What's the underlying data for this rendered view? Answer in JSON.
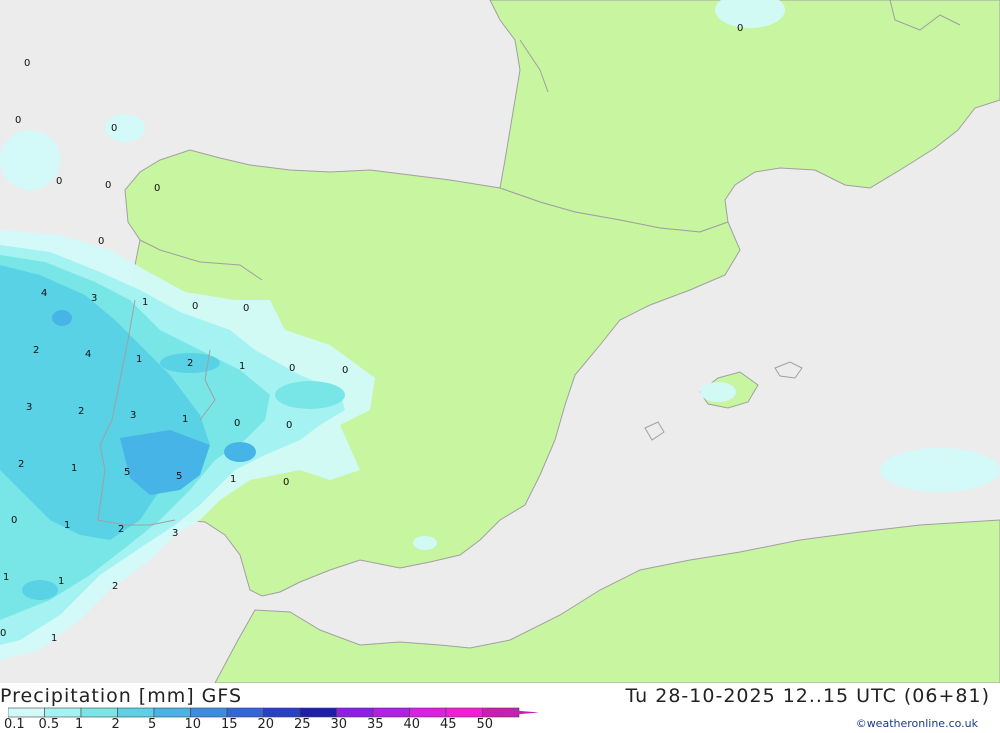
{
  "title": {
    "left": "Precipitation [mm] GFS",
    "right": "Tu 28-10-2025 12..15 UTC (06+81)"
  },
  "credit": "©weatheronline.co.uk",
  "legend": {
    "labels": [
      "0.1",
      "0.5",
      "1",
      "2",
      "5",
      "10",
      "15",
      "20",
      "25",
      "30",
      "35",
      "40",
      "45",
      "50"
    ],
    "colors": [
      "#d2fafa",
      "#a5f2f2",
      "#78e6e6",
      "#5ad2e6",
      "#46b4e6",
      "#3c8ce6",
      "#3264dc",
      "#2840c8",
      "#1e1eaa",
      "#8c1ee6",
      "#b41ee6",
      "#dc1ee6",
      "#f01edc",
      "#c81eb4"
    ]
  },
  "colors": {
    "land": "#c8f5a0",
    "sea": "#ececec",
    "border": "#a0a0a0"
  },
  "map_labels": [
    "0",
    "0",
    "0",
    "0",
    "0",
    "0",
    "0",
    "0",
    "0",
    "4",
    "3",
    "1",
    "0",
    "0",
    "2",
    "4",
    "1",
    "2",
    "1",
    "0",
    "0",
    "3",
    "2",
    "3",
    "1",
    "0",
    "0",
    "2",
    "1",
    "5",
    "5",
    "1",
    "0",
    "1",
    "2",
    "3",
    "1",
    "1",
    "2",
    "0",
    "1",
    "0"
  ]
}
